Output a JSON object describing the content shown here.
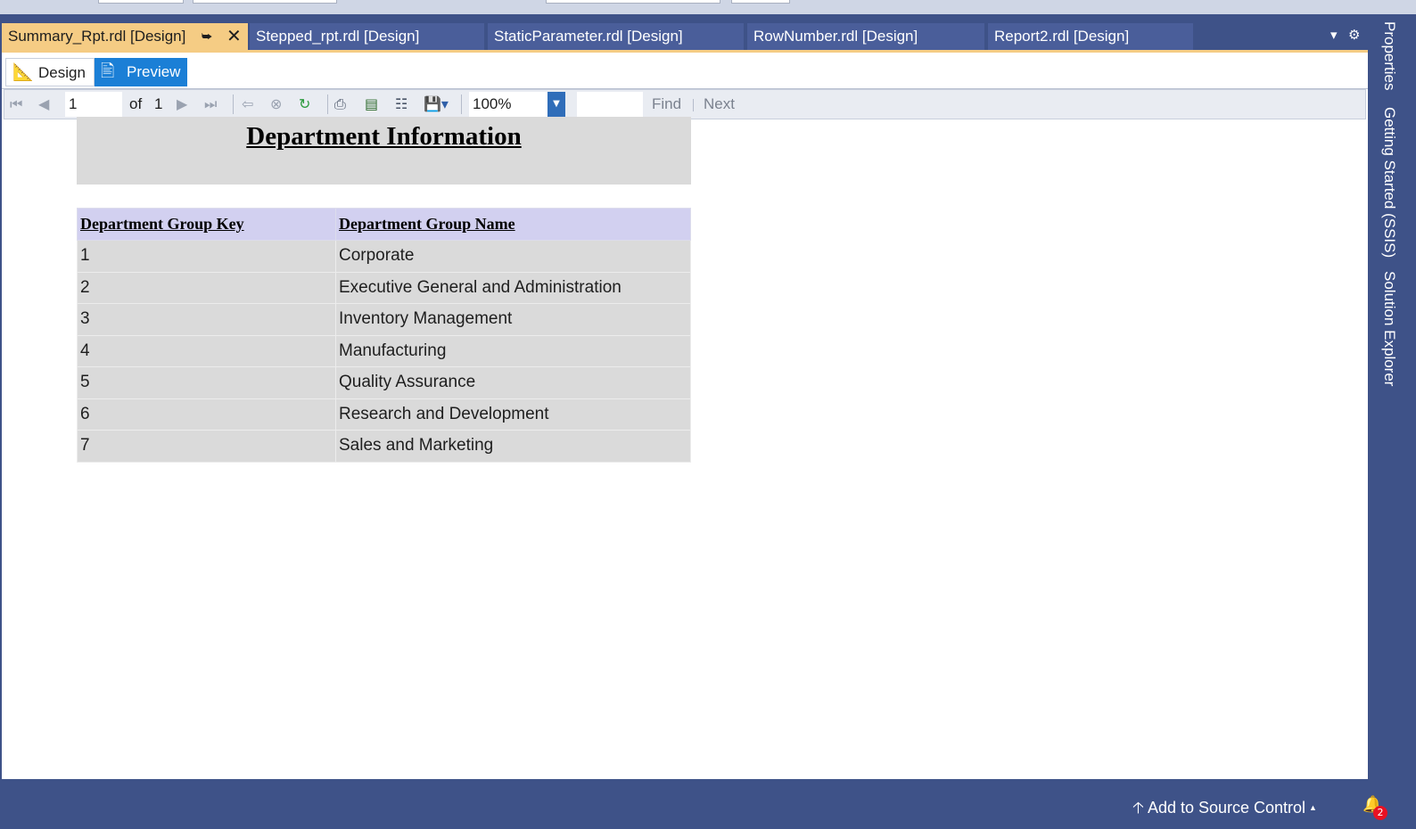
{
  "tabs": [
    {
      "label": "Summary_Rpt.rdl [Design]",
      "active": true
    },
    {
      "label": "Stepped_rpt.rdl [Design]"
    },
    {
      "label": "StaticParameter.rdl [Design]"
    },
    {
      "label": "RowNumber.rdl [Design]"
    },
    {
      "label": "Report2.rdl [Design]"
    }
  ],
  "modes": {
    "design": "Design",
    "preview": "Preview"
  },
  "toolbar": {
    "page_value": "1",
    "of_label": "of",
    "total_pages": "1",
    "zoom_value": "100%",
    "find_label": "Find",
    "next_label": "Next"
  },
  "report": {
    "title": "Department Information",
    "columns": [
      "Department Group Key",
      "Department Group Name"
    ],
    "rows": [
      [
        "1",
        "Corporate"
      ],
      [
        "2",
        "Executive General and Administration"
      ],
      [
        "3",
        "Inventory Management"
      ],
      [
        "4",
        "Manufacturing"
      ],
      [
        "5",
        "Quality Assurance"
      ],
      [
        "6",
        "Research and Development"
      ],
      [
        "7",
        "Sales and Marketing"
      ]
    ]
  },
  "right_rail": [
    "Properties",
    "Getting Started (SSIS)",
    "Solution Explorer"
  ],
  "statusbar": {
    "source_control": "Add to Source Control",
    "notification_count": "2"
  },
  "colors": {
    "frame": "#3e5288",
    "active_tab": "#f5cc84",
    "preview_button": "#1b7fd6",
    "table_header": "#d2d0f0",
    "table_cell": "#dadada"
  }
}
